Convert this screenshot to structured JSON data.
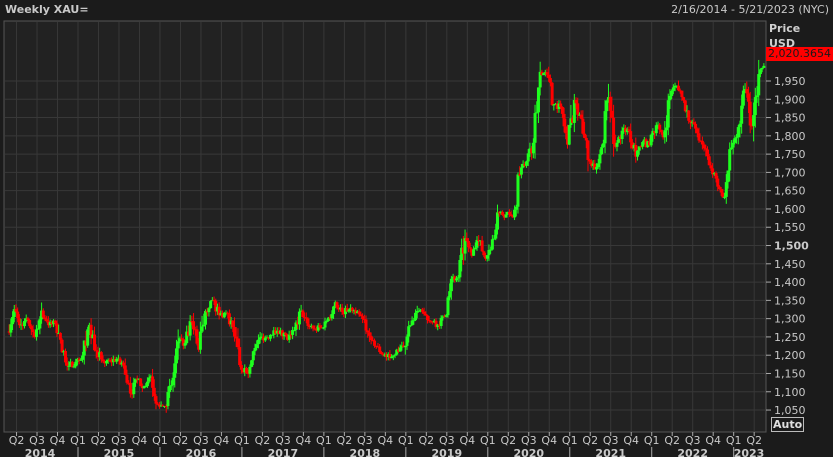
{
  "header": {
    "title": "Weekly XAU=",
    "date_range": "2/16/2014 - 5/21/2023 (NYC)"
  },
  "axis": {
    "price_label": "Price",
    "currency": "USD",
    "last_price": "2,020.3654",
    "auto_button": "Auto"
  },
  "colors": {
    "up": "#1eff1e",
    "down": "#ff0000",
    "background": "#222222",
    "grid": "#383838"
  },
  "chart_data": {
    "type": "candlestick",
    "title": "Weekly XAU=",
    "ylabel": "Price USD",
    "ylim": [
      1030,
      2070
    ],
    "yticks": [
      1050,
      1100,
      1150,
      1200,
      1250,
      1300,
      1350,
      1400,
      1450,
      1500,
      1550,
      1600,
      1650,
      1700,
      1750,
      1800,
      1850,
      1900,
      1950
    ],
    "ytick_labels": [
      "1,050",
      "1,100",
      "1,150",
      "1,200",
      "1,250",
      "1,300",
      "1,350",
      "1,400",
      "1,450",
      "1,500",
      "1,550",
      "1,600",
      "1,650",
      "1,700",
      "1,750",
      "1,800",
      "1,850",
      "1,900",
      "1,950"
    ],
    "start": "2014-02",
    "end": "2023-05",
    "monthly_closes_approx": [
      1326,
      1284,
      1296,
      1250,
      1322,
      1282,
      1287,
      1208,
      1171,
      1182,
      1199,
      1283,
      1212,
      1183,
      1183,
      1190,
      1172,
      1095,
      1133,
      1115,
      1142,
      1065,
      1061,
      1118,
      1238,
      1233,
      1293,
      1215,
      1321,
      1351,
      1309,
      1316,
      1277,
      1173,
      1151,
      1211,
      1249,
      1249,
      1268,
      1268,
      1242,
      1269,
      1322,
      1280,
      1271,
      1275,
      1303,
      1345,
      1318,
      1325,
      1315,
      1299,
      1253,
      1224,
      1201,
      1192,
      1215,
      1222,
      1282,
      1321,
      1313,
      1292,
      1284,
      1305,
      1409,
      1413,
      1520,
      1472,
      1513,
      1464,
      1517,
      1589,
      1585,
      1577,
      1694,
      1730,
      1781,
      1975,
      1967,
      1886,
      1879,
      1776,
      1898,
      1847,
      1734,
      1708,
      1769,
      1906,
      1770,
      1814,
      1813,
      1743,
      1783,
      1774,
      1829,
      1796,
      1909,
      1937,
      1897,
      1837,
      1807,
      1766,
      1711,
      1661,
      1633,
      1768,
      1824,
      1928,
      1827,
      1969,
      1990,
      2020
    ],
    "quarters": [
      "Q2",
      "Q3",
      "Q4",
      "Q1",
      "Q2",
      "Q3",
      "Q4",
      "Q1",
      "Q2",
      "Q3",
      "Q4",
      "Q1",
      "Q2",
      "Q3",
      "Q4",
      "Q1",
      "Q2",
      "Q3",
      "Q4",
      "Q1",
      "Q2",
      "Q3",
      "Q4",
      "Q1",
      "Q2",
      "Q3",
      "Q4",
      "Q1",
      "Q2",
      "Q3",
      "Q4",
      "Q1",
      "Q2",
      "Q3",
      "Q4",
      "Q1",
      "Q2"
    ],
    "years": [
      "2014",
      "2015",
      "2016",
      "2017",
      "2018",
      "2019",
      "2020",
      "2021",
      "2022",
      "2023"
    ],
    "grid": true
  }
}
